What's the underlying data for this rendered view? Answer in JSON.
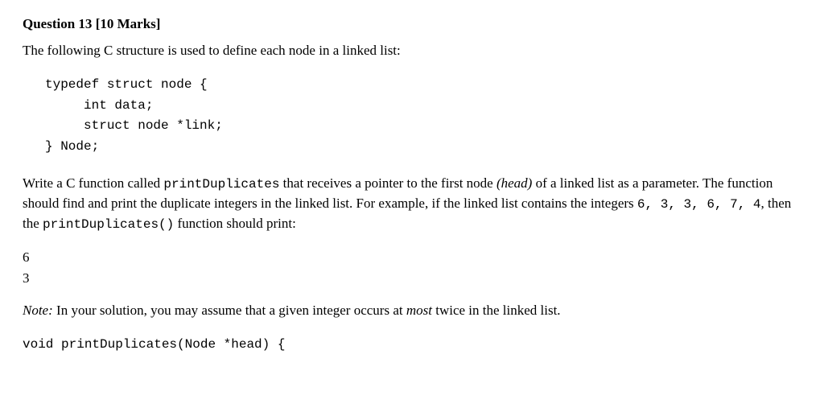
{
  "header": {
    "question_label": "Question 13",
    "marks": "[10 Marks]"
  },
  "intro": "The following C structure is used to define each node in a linked list:",
  "code_struct": "typedef struct node {\n     int data;\n     struct node *link;\n} Node;",
  "body": {
    "p1_a": "Write a C function called ",
    "fn1": "printDuplicates",
    "p1_b": " that receives a pointer to the first node ",
    "italic_head": "(head)",
    "p1_c": " of a linked list as a parameter. The function should find and print the duplicate integers in the linked list. For example, if the linked list contains the integers ",
    "nums": "6,  3,  3,  6,  7,  4",
    "p1_d": ", then the ",
    "fn2": "printDuplicates()",
    "p1_e": " function should print:"
  },
  "output": {
    "line1": "6",
    "line2": "3"
  },
  "note": {
    "label": "Note:",
    "text_a": " In your solution, you may assume that a given integer occurs at ",
    "italic_most": "most",
    "text_b": " twice in the linked list."
  },
  "fn_sig": "void printDuplicates(Node *head) {"
}
